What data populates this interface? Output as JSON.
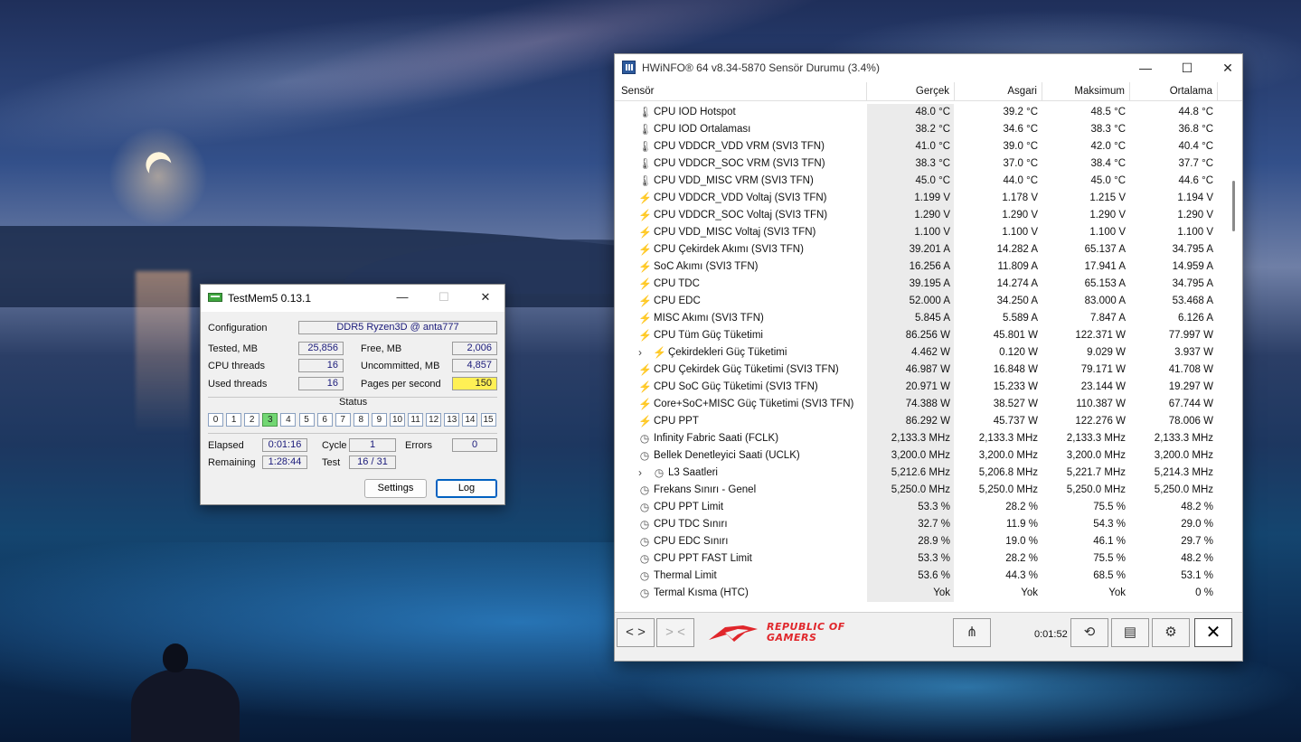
{
  "testmem": {
    "title": "TestMem5  0.13.1",
    "configuration_label": "Configuration",
    "configuration_value": "DDR5 Ryzen3D @ anta777",
    "tested_label": "Tested, MB",
    "tested_value": "25,856",
    "free_label": "Free, MB",
    "free_value": "2,006",
    "cpu_threads_label": "CPU threads",
    "cpu_threads_value": "16",
    "uncommitted_label": "Uncommitted, MB",
    "uncommitted_value": "4,857",
    "used_threads_label": "Used threads",
    "used_threads_value": "16",
    "pages_label": "Pages per second",
    "pages_value": "150",
    "status_label": "Status",
    "status_cells": [
      "0",
      "1",
      "2",
      "3",
      "4",
      "5",
      "6",
      "7",
      "8",
      "9",
      "10",
      "11",
      "12",
      "13",
      "14",
      "15"
    ],
    "status_active": 3,
    "elapsed_label": "Elapsed",
    "elapsed_value": "0:01:16",
    "cycle_label": "Cycle",
    "cycle_value": "1",
    "errors_label": "Errors",
    "errors_value": "0",
    "remaining_label": "Remaining",
    "remaining_value": "1:28:44",
    "test_label": "Test",
    "test_value": "16 / 31",
    "settings_button": "Settings",
    "log_button": "Log",
    "min_glyph": "—",
    "max_glyph": "☐",
    "close_glyph": "✕"
  },
  "hwinfo": {
    "title": "HWiNFO® 64 v8.34-5870 Sensör Durumu (3.4%)",
    "min_glyph": "—",
    "max_glyph": "☐",
    "close_glyph": "✕",
    "columns": [
      "Sensör",
      "Gerçek",
      "Asgari",
      "Maksimum",
      "Ortalama"
    ],
    "rows": [
      {
        "icon": "thermometer-icon",
        "glyph": "🌡",
        "name": "CPU IOD Hotspot",
        "cur": "48.0 °C",
        "min": "39.2 °C",
        "max": "48.5 °C",
        "avg": "44.8 °C"
      },
      {
        "icon": "thermometer-icon",
        "glyph": "🌡",
        "name": "CPU IOD Ortalaması",
        "cur": "38.2 °C",
        "min": "34.6 °C",
        "max": "38.3 °C",
        "avg": "36.8 °C"
      },
      {
        "icon": "thermometer-icon",
        "glyph": "🌡",
        "name": "CPU VDDCR_VDD VRM (SVI3 TFN)",
        "cur": "41.0 °C",
        "min": "39.0 °C",
        "max": "42.0 °C",
        "avg": "40.4 °C"
      },
      {
        "icon": "thermometer-icon",
        "glyph": "🌡",
        "name": "CPU VDDCR_SOC VRM (SVI3 TFN)",
        "cur": "38.3 °C",
        "min": "37.0 °C",
        "max": "38.4 °C",
        "avg": "37.7 °C"
      },
      {
        "icon": "thermometer-icon",
        "glyph": "🌡",
        "name": "CPU VDD_MISC VRM (SVI3 TFN)",
        "cur": "45.0 °C",
        "min": "44.0 °C",
        "max": "45.0 °C",
        "avg": "44.6 °C"
      },
      {
        "icon": "bolt-icon",
        "glyph": "⚡",
        "name": "CPU VDDCR_VDD Voltaj (SVI3 TFN)",
        "cur": "1.199 V",
        "min": "1.178 V",
        "max": "1.215 V",
        "avg": "1.194 V"
      },
      {
        "icon": "bolt-icon",
        "glyph": "⚡",
        "name": "CPU VDDCR_SOC Voltaj (SVI3 TFN)",
        "cur": "1.290 V",
        "min": "1.290 V",
        "max": "1.290 V",
        "avg": "1.290 V"
      },
      {
        "icon": "bolt-icon",
        "glyph": "⚡",
        "name": "CPU VDD_MISC Voltaj (SVI3 TFN)",
        "cur": "1.100 V",
        "min": "1.100 V",
        "max": "1.100 V",
        "avg": "1.100 V"
      },
      {
        "icon": "bolt-icon",
        "glyph": "⚡",
        "name": "CPU Çekirdek Akımı (SVI3 TFN)",
        "cur": "39.201 A",
        "min": "14.282 A",
        "max": "65.137 A",
        "avg": "34.795 A"
      },
      {
        "icon": "bolt-icon",
        "glyph": "⚡",
        "name": "SoC Akımı (SVI3 TFN)",
        "cur": "16.256 A",
        "min": "11.809 A",
        "max": "17.941 A",
        "avg": "14.959 A"
      },
      {
        "icon": "bolt-icon",
        "glyph": "⚡",
        "name": "CPU TDC",
        "cur": "39.195 A",
        "min": "14.274 A",
        "max": "65.153 A",
        "avg": "34.795 A"
      },
      {
        "icon": "bolt-icon",
        "glyph": "⚡",
        "name": "CPU EDC",
        "cur": "52.000 A",
        "min": "34.250 A",
        "max": "83.000 A",
        "avg": "53.468 A"
      },
      {
        "icon": "bolt-icon",
        "glyph": "⚡",
        "name": "MISC Akımı (SVI3 TFN)",
        "cur": "5.845 A",
        "min": "5.589 A",
        "max": "7.847 A",
        "avg": "6.126 A"
      },
      {
        "icon": "bolt-icon",
        "glyph": "⚡",
        "name": "CPU Tüm Güç Tüketimi",
        "cur": "86.256 W",
        "min": "45.801 W",
        "max": "122.371 W",
        "avg": "77.997 W"
      },
      {
        "icon": "bolt-icon",
        "glyph": "⚡",
        "name": "Çekirdekleri Güç Tüketimi",
        "cur": "4.462 W",
        "min": "0.120 W",
        "max": "9.029 W",
        "avg": "3.937 W",
        "expandable": true
      },
      {
        "icon": "bolt-icon",
        "glyph": "⚡",
        "name": "CPU Çekirdek Güç Tüketimi (SVI3 TFN)",
        "cur": "46.987 W",
        "min": "16.848 W",
        "max": "79.171 W",
        "avg": "41.708 W"
      },
      {
        "icon": "bolt-icon",
        "glyph": "⚡",
        "name": "CPU SoC Güç Tüketimi (SVI3 TFN)",
        "cur": "20.971 W",
        "min": "15.233 W",
        "max": "23.144 W",
        "avg": "19.297 W"
      },
      {
        "icon": "bolt-icon",
        "glyph": "⚡",
        "name": "Core+SoC+MISC Güç Tüketimi (SVI3 TFN)",
        "cur": "74.388 W",
        "min": "38.527 W",
        "max": "110.387 W",
        "avg": "67.744 W"
      },
      {
        "icon": "bolt-icon",
        "glyph": "⚡",
        "name": "CPU PPT",
        "cur": "86.292 W",
        "min": "45.737 W",
        "max": "122.276 W",
        "avg": "78.006 W"
      },
      {
        "icon": "clock-icon",
        "glyph": "◷",
        "name": "Infinity Fabric Saati (FCLK)",
        "cur": "2,133.3 MHz",
        "min": "2,133.3 MHz",
        "max": "2,133.3 MHz",
        "avg": "2,133.3 MHz"
      },
      {
        "icon": "clock-icon",
        "glyph": "◷",
        "name": "Bellek Denetleyici Saati (UCLK)",
        "cur": "3,200.0 MHz",
        "min": "3,200.0 MHz",
        "max": "3,200.0 MHz",
        "avg": "3,200.0 MHz"
      },
      {
        "icon": "clock-icon",
        "glyph": "◷",
        "name": "L3 Saatleri",
        "cur": "5,212.6 MHz",
        "min": "5,206.8 MHz",
        "max": "5,221.7 MHz",
        "avg": "5,214.3 MHz",
        "expandable": true
      },
      {
        "icon": "clock-icon",
        "glyph": "◷",
        "name": "Frekans Sınırı - Genel",
        "cur": "5,250.0 MHz",
        "min": "5,250.0 MHz",
        "max": "5,250.0 MHz",
        "avg": "5,250.0 MHz"
      },
      {
        "icon": "clock-icon",
        "glyph": "◷",
        "name": "CPU PPT Limit",
        "cur": "53.3 %",
        "min": "28.2 %",
        "max": "75.5 %",
        "avg": "48.2 %"
      },
      {
        "icon": "clock-icon",
        "glyph": "◷",
        "name": "CPU TDC Sınırı",
        "cur": "32.7 %",
        "min": "11.9 %",
        "max": "54.3 %",
        "avg": "29.0 %"
      },
      {
        "icon": "clock-icon",
        "glyph": "◷",
        "name": "CPU EDC Sınırı",
        "cur": "28.9 %",
        "min": "19.0 %",
        "max": "46.1 %",
        "avg": "29.7 %"
      },
      {
        "icon": "clock-icon",
        "glyph": "◷",
        "name": "CPU PPT FAST Limit",
        "cur": "53.3 %",
        "min": "28.2 %",
        "max": "75.5 %",
        "avg": "48.2 %"
      },
      {
        "icon": "clock-icon",
        "glyph": "◷",
        "name": "Thermal Limit",
        "cur": "53.6 %",
        "min": "44.3 %",
        "max": "68.5 %",
        "avg": "53.1 %"
      },
      {
        "icon": "clock-icon",
        "glyph": "◷",
        "name": "Termal Kısma (HTC)",
        "cur": "Yok",
        "min": "Yok",
        "max": "Yok",
        "avg": "0 %"
      }
    ],
    "footer": {
      "nav_left": "<  >",
      "nav_collapse": ">  <",
      "brand_line1": "REPUBLIC OF",
      "brand_line2": "GAMERS",
      "timer": "0:01:52",
      "share_glyph": "⋔",
      "reset_glyph": "⟲",
      "report_glyph": "▤",
      "settings_glyph": "⚙",
      "close_glyph": "✕"
    }
  }
}
